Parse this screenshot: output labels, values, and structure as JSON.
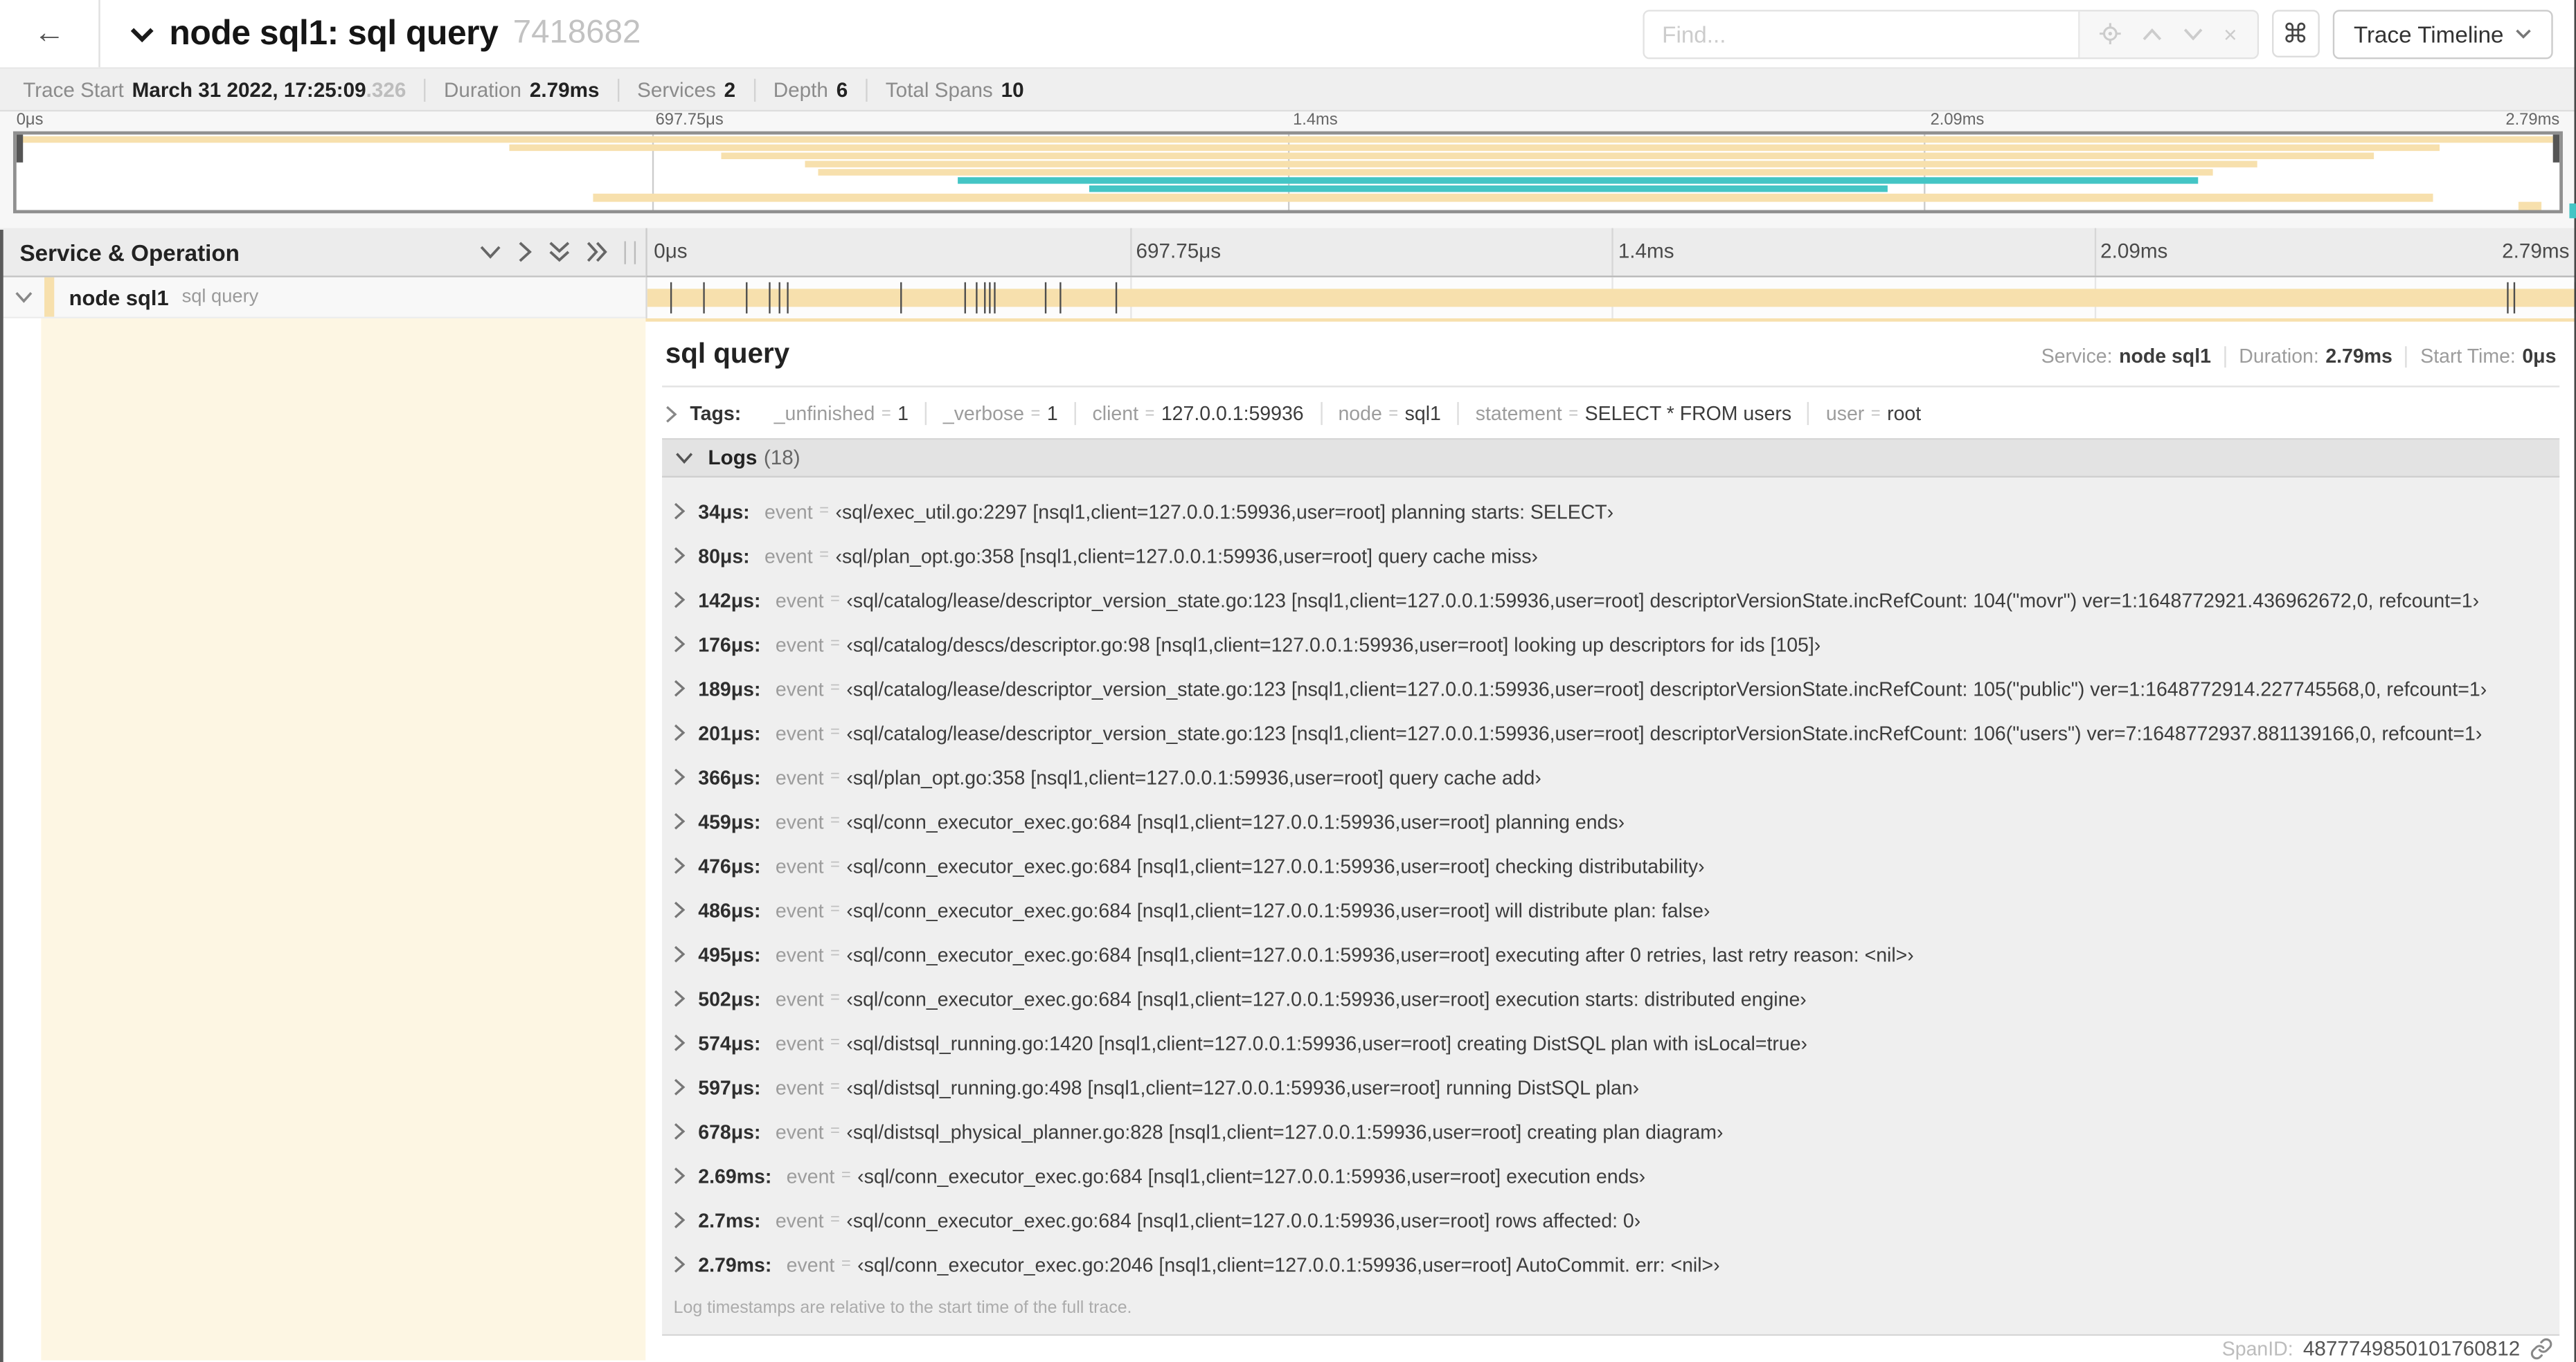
{
  "header": {
    "back_arrow": "←",
    "title": "node sql1: sql query",
    "trace_id_suffix": "7418682",
    "find_placeholder": "Find...",
    "shortcuts_key": "⌘",
    "view_selector": "Trace Timeline"
  },
  "trace_info": {
    "items": [
      {
        "label": "Trace Start",
        "value": "March 31 2022, 17:25:09",
        "muted": ".326"
      },
      {
        "label": "Duration",
        "value": "2.79ms",
        "muted": ""
      },
      {
        "label": "Services",
        "value": "2",
        "muted": ""
      },
      {
        "label": "Depth",
        "value": "6",
        "muted": ""
      },
      {
        "label": "Total Spans",
        "value": "10",
        "muted": ""
      }
    ]
  },
  "minimap": {
    "ticks": [
      "0μs",
      "697.75μs",
      "1.4ms",
      "2.09ms",
      "2.79ms"
    ],
    "spans": [
      {
        "start": 0,
        "end": 100,
        "color": "tan"
      },
      {
        "start": 19.4,
        "end": 95.3,
        "color": "tan"
      },
      {
        "start": 27.7,
        "end": 92.7,
        "color": "tan"
      },
      {
        "start": 31.0,
        "end": 88.1,
        "color": "tan"
      },
      {
        "start": 31.5,
        "end": 86.4,
        "color": "tan"
      },
      {
        "start": 37.0,
        "end": 85.8,
        "color": "teal"
      },
      {
        "start": 42.2,
        "end": 73.6,
        "color": "teal"
      },
      {
        "start": 22.7,
        "end": 95.0,
        "color": "tan"
      },
      {
        "start": 98.4,
        "end": 99.3,
        "color": "tan"
      }
    ]
  },
  "timeline": {
    "left_header": "Service & Operation",
    "ruler_ticks": [
      "0μs",
      "697.75μs",
      "1.4ms",
      "2.09ms",
      "2.79ms"
    ],
    "row": {
      "service": "node sql1",
      "operation": "sql query"
    },
    "log_marker_times_us": [
      34,
      80,
      142,
      176,
      189,
      201,
      366,
      459,
      476,
      486,
      495,
      502,
      574,
      597,
      678,
      2690,
      2700,
      2790
    ],
    "trace_duration_us": 2790
  },
  "detail": {
    "title": "sql query",
    "summary": [
      {
        "label": "Service:",
        "value": "node sql1"
      },
      {
        "label": "Duration:",
        "value": "2.79ms"
      },
      {
        "label": "Start Time:",
        "value": "0μs"
      }
    ],
    "tags": {
      "label": "Tags:",
      "items": [
        {
          "key": "_unfinished",
          "value": "1"
        },
        {
          "key": "_verbose",
          "value": "1"
        },
        {
          "key": "client",
          "value": "127.0.0.1:59936"
        },
        {
          "key": "node",
          "value": "sql1"
        },
        {
          "key": "statement",
          "value": "SELECT * FROM users"
        },
        {
          "key": "user",
          "value": "root"
        }
      ]
    },
    "logs": {
      "label": "Logs",
      "count": "(18)",
      "field": "event",
      "entries": [
        {
          "time": "34μs:",
          "value": "‹sql/exec_util.go:2297 [nsql1,client=127.0.0.1:59936,user=root] planning starts: SELECT›"
        },
        {
          "time": "80μs:",
          "value": "‹sql/plan_opt.go:358 [nsql1,client=127.0.0.1:59936,user=root] query cache miss›"
        },
        {
          "time": "142μs:",
          "value": "‹sql/catalog/lease/descriptor_version_state.go:123 [nsql1,client=127.0.0.1:59936,user=root] descriptorVersionState.incRefCount: 104(\"movr\") ver=1:1648772921.436962672,0, refcount=1›"
        },
        {
          "time": "176μs:",
          "value": "‹sql/catalog/descs/descriptor.go:98 [nsql1,client=127.0.0.1:59936,user=root] looking up descriptors for ids [105]›"
        },
        {
          "time": "189μs:",
          "value": "‹sql/catalog/lease/descriptor_version_state.go:123 [nsql1,client=127.0.0.1:59936,user=root] descriptorVersionState.incRefCount: 105(\"public\") ver=1:1648772914.227745568,0, refcount=1›"
        },
        {
          "time": "201μs:",
          "value": "‹sql/catalog/lease/descriptor_version_state.go:123 [nsql1,client=127.0.0.1:59936,user=root] descriptorVersionState.incRefCount: 106(\"users\") ver=7:1648772937.881139166,0, refcount=1›"
        },
        {
          "time": "366μs:",
          "value": "‹sql/plan_opt.go:358 [nsql1,client=127.0.0.1:59936,user=root] query cache add›"
        },
        {
          "time": "459μs:",
          "value": "‹sql/conn_executor_exec.go:684 [nsql1,client=127.0.0.1:59936,user=root] planning ends›"
        },
        {
          "time": "476μs:",
          "value": "‹sql/conn_executor_exec.go:684 [nsql1,client=127.0.0.1:59936,user=root] checking distributability›"
        },
        {
          "time": "486μs:",
          "value": "‹sql/conn_executor_exec.go:684 [nsql1,client=127.0.0.1:59936,user=root] will distribute plan: false›"
        },
        {
          "time": "495μs:",
          "value": "‹sql/conn_executor_exec.go:684 [nsql1,client=127.0.0.1:59936,user=root] executing after 0 retries, last retry reason: <nil>›"
        },
        {
          "time": "502μs:",
          "value": "‹sql/conn_executor_exec.go:684 [nsql1,client=127.0.0.1:59936,user=root] execution starts: distributed engine›"
        },
        {
          "time": "574μs:",
          "value": "‹sql/distsql_running.go:1420 [nsql1,client=127.0.0.1:59936,user=root] creating DistSQL plan with isLocal=true›"
        },
        {
          "time": "597μs:",
          "value": "‹sql/distsql_running.go:498 [nsql1,client=127.0.0.1:59936,user=root] running DistSQL plan›"
        },
        {
          "time": "678μs:",
          "value": "‹sql/distsql_physical_planner.go:828 [nsql1,client=127.0.0.1:59936,user=root] creating plan diagram›"
        },
        {
          "time": "2.69ms:",
          "value": "‹sql/conn_executor_exec.go:684 [nsql1,client=127.0.0.1:59936,user=root] execution ends›"
        },
        {
          "time": "2.7ms:",
          "value": "‹sql/conn_executor_exec.go:684 [nsql1,client=127.0.0.1:59936,user=root] rows affected: 0›"
        },
        {
          "time": "2.79ms:",
          "value": "‹sql/conn_executor_exec.go:2046 [nsql1,client=127.0.0.1:59936,user=root] AutoCommit. err: <nil>›"
        }
      ],
      "footnote": "Log timestamps are relative to the start time of the full trace."
    },
    "span_id_label": "SpanID:",
    "span_id": "4877749850101760812"
  },
  "colors": {
    "span_tan": "#f7e0ad",
    "span_teal": "#44c5c5",
    "detail_cream": "#fdf6e3"
  }
}
